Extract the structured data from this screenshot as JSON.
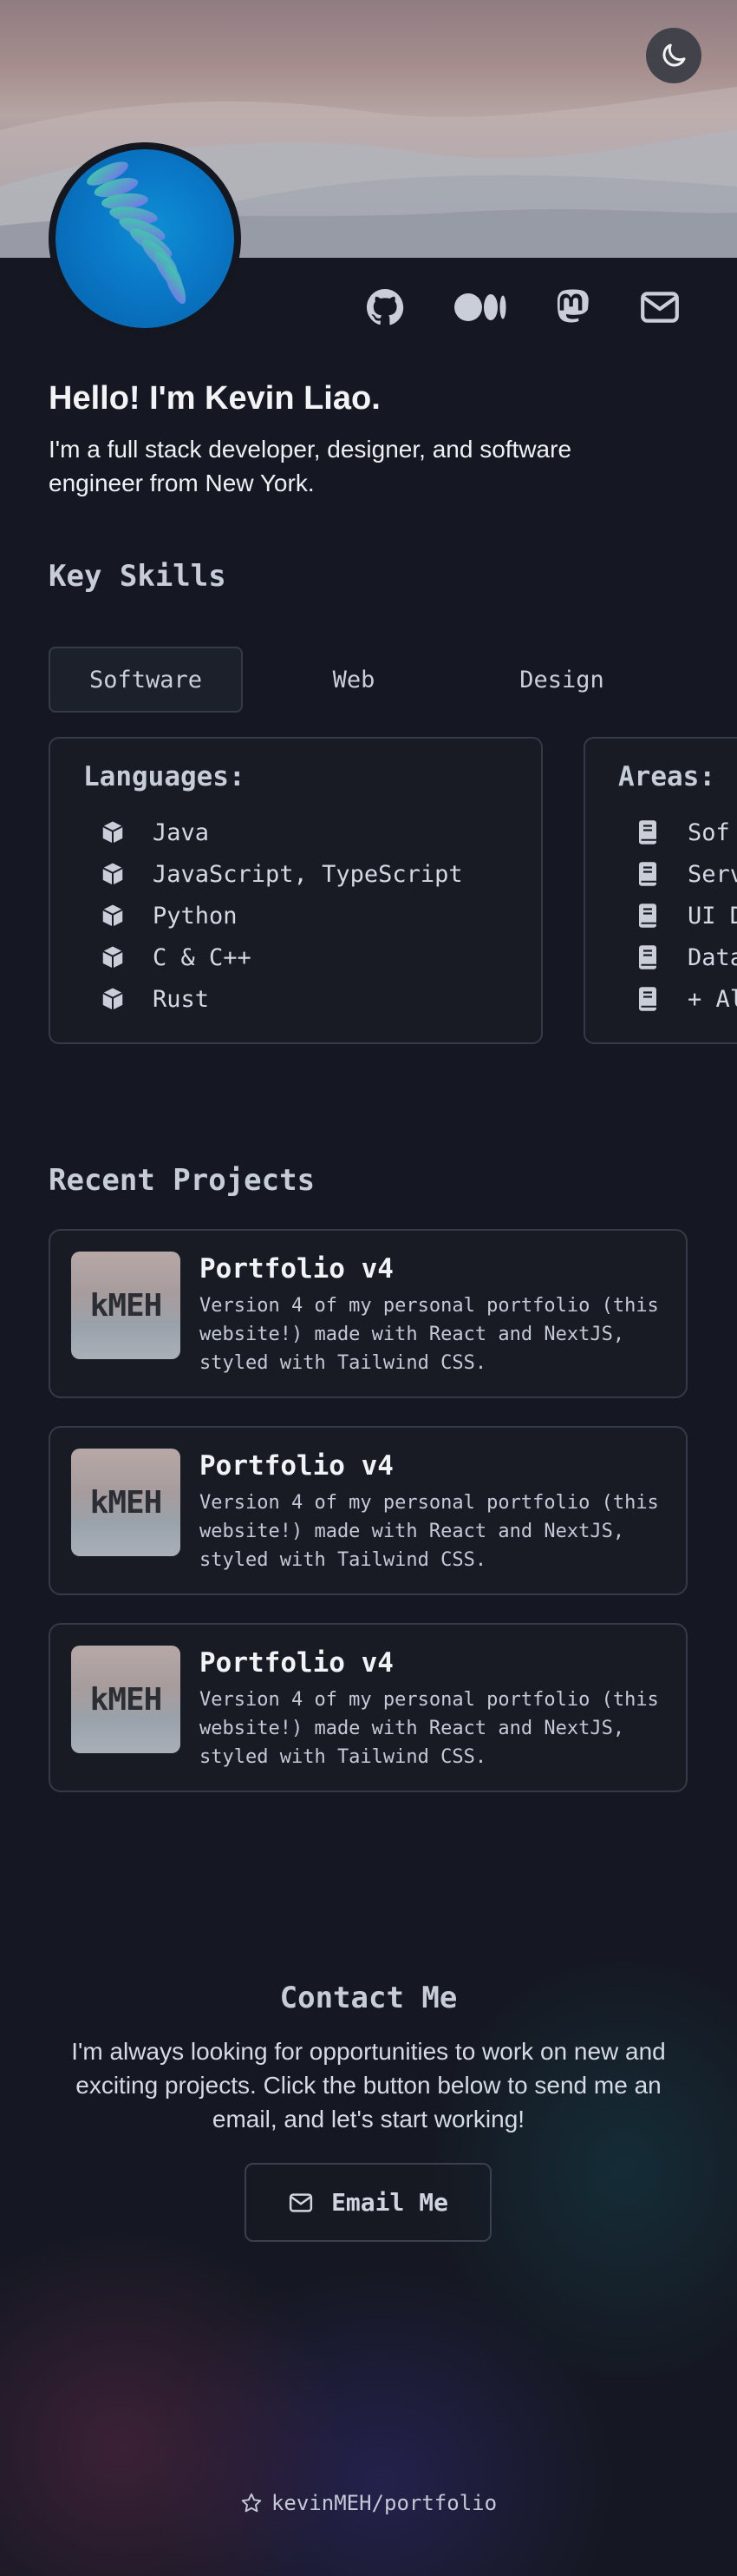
{
  "header": {
    "theme_toggle_icon": "moon-icon",
    "social_links": [
      {
        "icon": "github-icon"
      },
      {
        "icon": "medium-icon"
      },
      {
        "icon": "mastodon-icon"
      },
      {
        "icon": "mail-icon"
      }
    ]
  },
  "intro": {
    "greeting": "Hello! I'm Kevin Liao.",
    "bio": "I'm a full stack developer, designer, and software engineer from New York."
  },
  "skills": {
    "title": "Key Skills",
    "tabs": [
      "Software",
      "Web",
      "Design"
    ],
    "active_tab": "Software",
    "cards": [
      {
        "title": "Languages:",
        "icon": "cube-icon",
        "items": [
          "Java",
          "JavaScript, TypeScript",
          "Python",
          "C & C++",
          "Rust"
        ]
      },
      {
        "title": "Areas:",
        "icon": "book-icon",
        "items": [
          "Sof",
          "Serv",
          "UI D",
          "Data",
          "+ Al"
        ]
      }
    ]
  },
  "projects": {
    "title": "Recent Projects",
    "items": [
      {
        "thumb_text": "kMEH",
        "title": "Portfolio v4",
        "description": "Version 4 of my personal portfolio (this website!) made with React and NextJS, styled with Tailwind CSS."
      },
      {
        "thumb_text": "kMEH",
        "title": "Portfolio v4",
        "description": "Version 4 of my personal portfolio (this website!) made with React and NextJS, styled with Tailwind CSS."
      },
      {
        "thumb_text": "kMEH",
        "title": "Portfolio v4",
        "description": "Version 4 of my personal portfolio (this website!) made with React and NextJS, styled with Tailwind CSS."
      }
    ]
  },
  "contact": {
    "title": "Contact Me",
    "text": "I'm always looking for opportunities to work on new and exciting projects. Click the button below to send me an email, and let's start working!",
    "button_label": "Email Me",
    "button_icon": "mail-icon"
  },
  "footer": {
    "icon": "star-icon",
    "label": "kevinMEH/portfolio"
  },
  "colors": {
    "background": "#151822",
    "card_border": "#343a47",
    "heading": "#c7ccd9"
  }
}
